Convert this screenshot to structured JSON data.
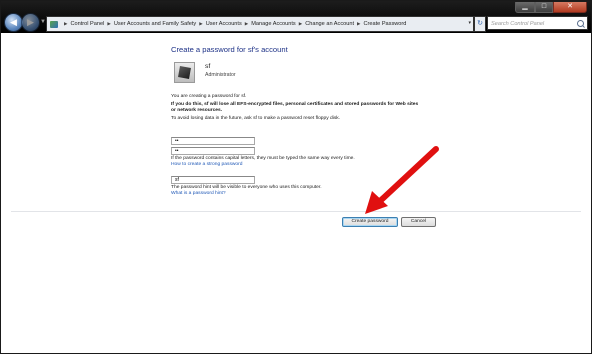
{
  "window": {
    "minimize_glyph": "▁",
    "maximize_glyph": "□",
    "close_glyph": "✕"
  },
  "nav": {
    "back_glyph": "◀",
    "forward_glyph": "▶",
    "dropdown_glyph": "▼"
  },
  "address": {
    "lead_separator": "▶",
    "breadcrumbs": [
      "Control Panel",
      "User Accounts and Family Safety",
      "User Accounts",
      "Manage Accounts",
      "Change an Account",
      "Create Password"
    ],
    "separator": "▶",
    "dropdown_glyph": "▾",
    "refresh_glyph": "↻"
  },
  "search": {
    "placeholder": "Search Control Panel"
  },
  "page": {
    "title": "Create a password for sf's account",
    "user": {
      "name": "sf",
      "role": "Administrator"
    },
    "intro": "You are creating a password for sf.",
    "warning_line1": "If you do this, sf will lose all EFS-encrypted files, personal certificates and stored passwords for Web sites",
    "warning_line2": "or network resources.",
    "tip": "To avoid losing data in the future, ask sf to make a password reset floppy disk.",
    "password_value": "••",
    "confirm_value": "••",
    "case_note": "If the password contains capital letters, they must be typed the same way every time.",
    "strong_link": "How to create a strong password",
    "hint_value": "sf",
    "hint_note": "The password hint will be visible to everyone who uses this computer.",
    "hint_link": "What is a password hint?"
  },
  "buttons": {
    "create": "Create password",
    "cancel": "Cancel"
  },
  "colors": {
    "annotation_arrow": "#e01010",
    "title": "#1e3287",
    "link": "#1e57b6"
  },
  "icons": {
    "user_picture": "user-picture-icon",
    "control_panel": "control-panel-icon",
    "search": "search-icon",
    "refresh": "refresh-icon",
    "annotation": "red-arrow-annotation"
  }
}
